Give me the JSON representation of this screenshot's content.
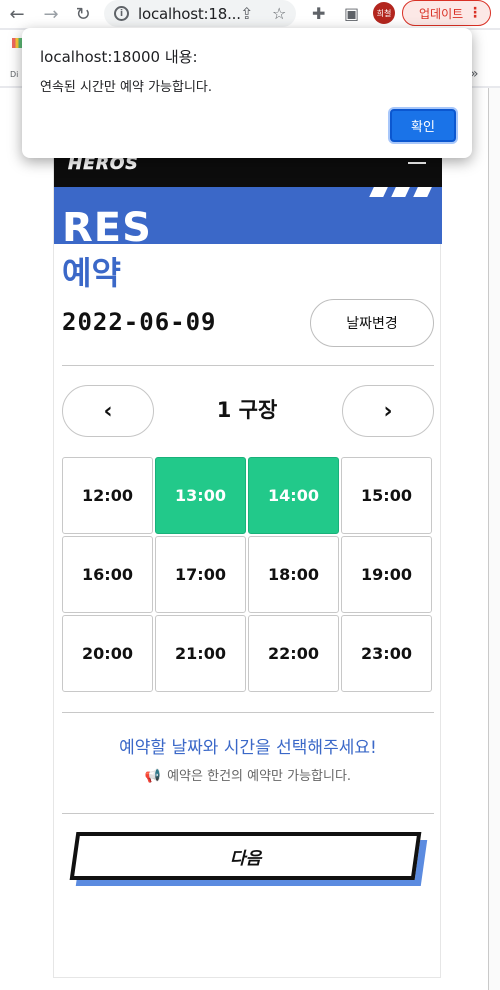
{
  "browser": {
    "url": "localhost:18...",
    "profile_initials": "희철",
    "update_label": "업데이트",
    "bookmark_hint": "Di"
  },
  "app": {
    "logo": "HEROS",
    "banner_text": "RES",
    "page_title": "예약",
    "selected_date": "2022-06-09",
    "change_date_label": "날짜변경",
    "court": {
      "prev": "‹",
      "name": "1 구장",
      "next": "›"
    },
    "time_slots": [
      {
        "time": "12:00",
        "selected": false
      },
      {
        "time": "13:00",
        "selected": true
      },
      {
        "time": "14:00",
        "selected": true
      },
      {
        "time": "15:00",
        "selected": false
      },
      {
        "time": "16:00",
        "selected": false
      },
      {
        "time": "17:00",
        "selected": false
      },
      {
        "time": "18:00",
        "selected": false
      },
      {
        "time": "19:00",
        "selected": false
      },
      {
        "time": "20:00",
        "selected": false
      },
      {
        "time": "21:00",
        "selected": false
      },
      {
        "time": "22:00",
        "selected": false
      },
      {
        "time": "23:00",
        "selected": false
      }
    ],
    "message_main": "예약할 날짜와 시간을 선택해주세요!",
    "message_note": "예약은 한건의 예약만 가능합니다.",
    "next_label": "다음"
  },
  "dialog": {
    "title": "localhost:18000 내용:",
    "message": "연속된 시간만 예약 가능합니다.",
    "ok_label": "확인"
  },
  "colors": {
    "accent_blue": "#3b68c8",
    "selected_green": "#22c98a",
    "header_black": "#0d0d0d",
    "dialog_button": "#1a73e8"
  }
}
